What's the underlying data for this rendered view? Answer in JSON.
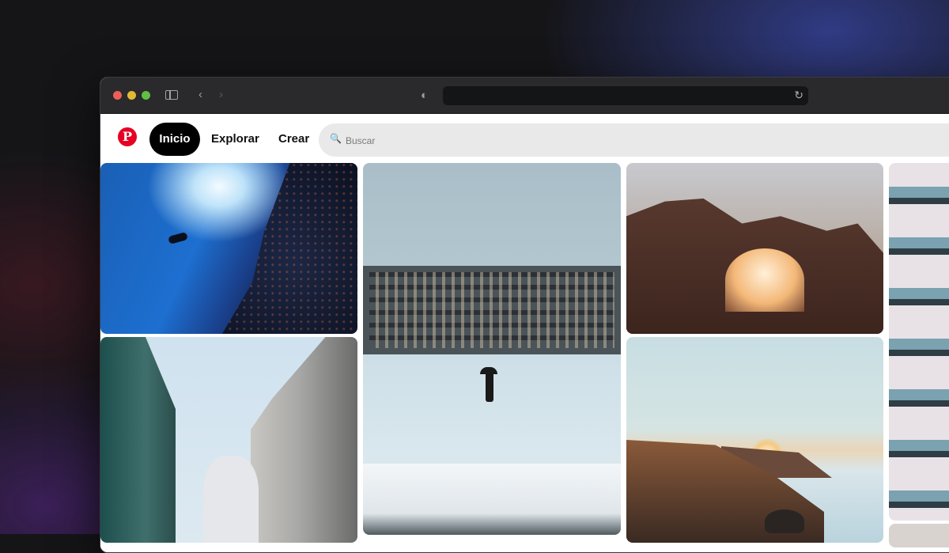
{
  "browser": {
    "traffic_lights": [
      "close",
      "minimize",
      "zoom"
    ],
    "url": "",
    "icons": [
      "sidebar-icon",
      "back-icon",
      "forward-icon",
      "shield-icon",
      "reload-icon"
    ]
  },
  "header": {
    "logo": "P",
    "nav": {
      "home": "Inicio",
      "explore": "Explorar",
      "create": "Crear"
    },
    "search": {
      "placeholder": "Buscar",
      "value": ""
    }
  },
  "colors": {
    "brand": "#e60023",
    "active_nav_bg": "#000000",
    "search_bg": "#e9e9e9"
  },
  "pins": [
    {
      "subject": "underwater diver with fish school"
    },
    {
      "subject": "white statue between old buildings"
    },
    {
      "subject": "person with umbrella walking in snow"
    },
    {
      "subject": "desert rock arch at sunset"
    },
    {
      "subject": "sunset over coastal cliffs"
    },
    {
      "subject": "colorful apartment balconies"
    }
  ]
}
